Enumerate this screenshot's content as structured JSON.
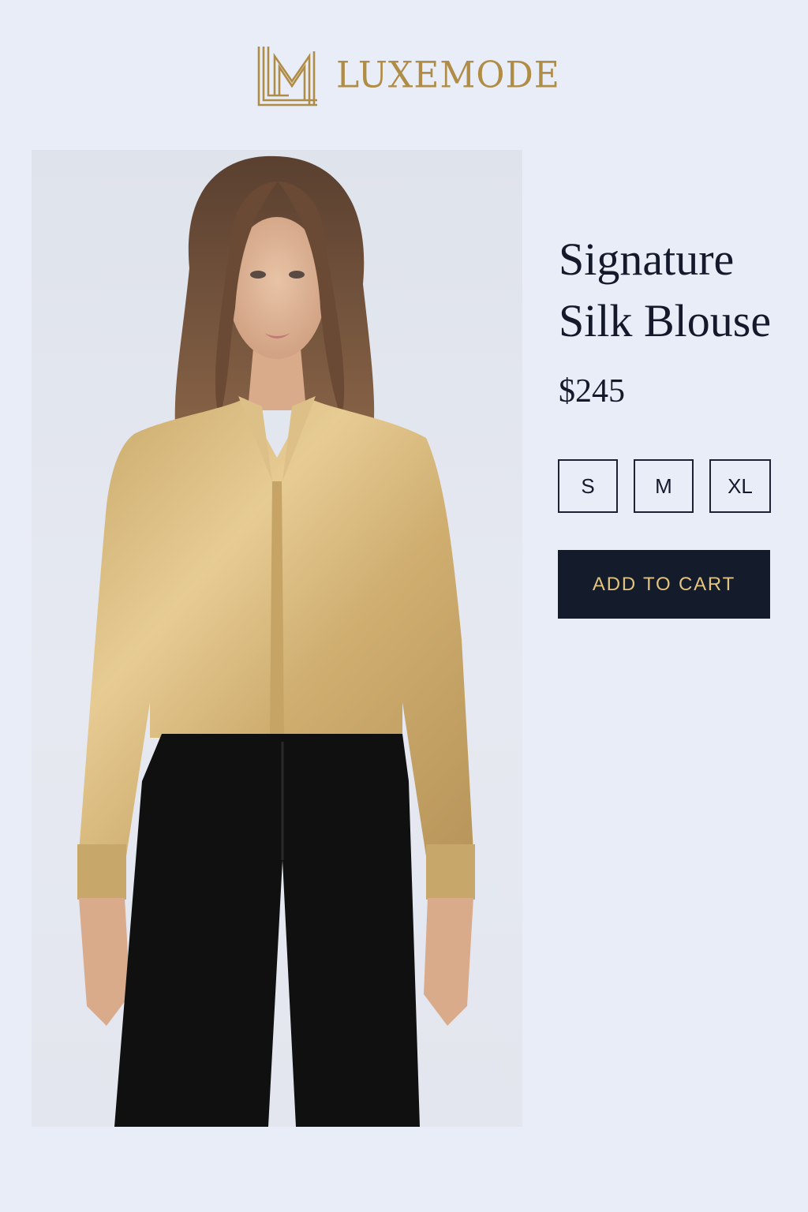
{
  "brand": {
    "name": "LUXEMODE",
    "logo_icon": "lm-monogram-icon",
    "accent_color": "#b08d47"
  },
  "product": {
    "image_icon": "model-wearing-blouse-photo",
    "title_line1": "Signature",
    "title_line2": "Silk Blouse",
    "price": "$245"
  },
  "sizes": [
    {
      "label": "S"
    },
    {
      "label": "M"
    },
    {
      "label": "XL"
    }
  ],
  "cart": {
    "button_label": "ADD TO CART",
    "button_bg": "#141b2b",
    "button_text_color": "#e2c47e"
  }
}
